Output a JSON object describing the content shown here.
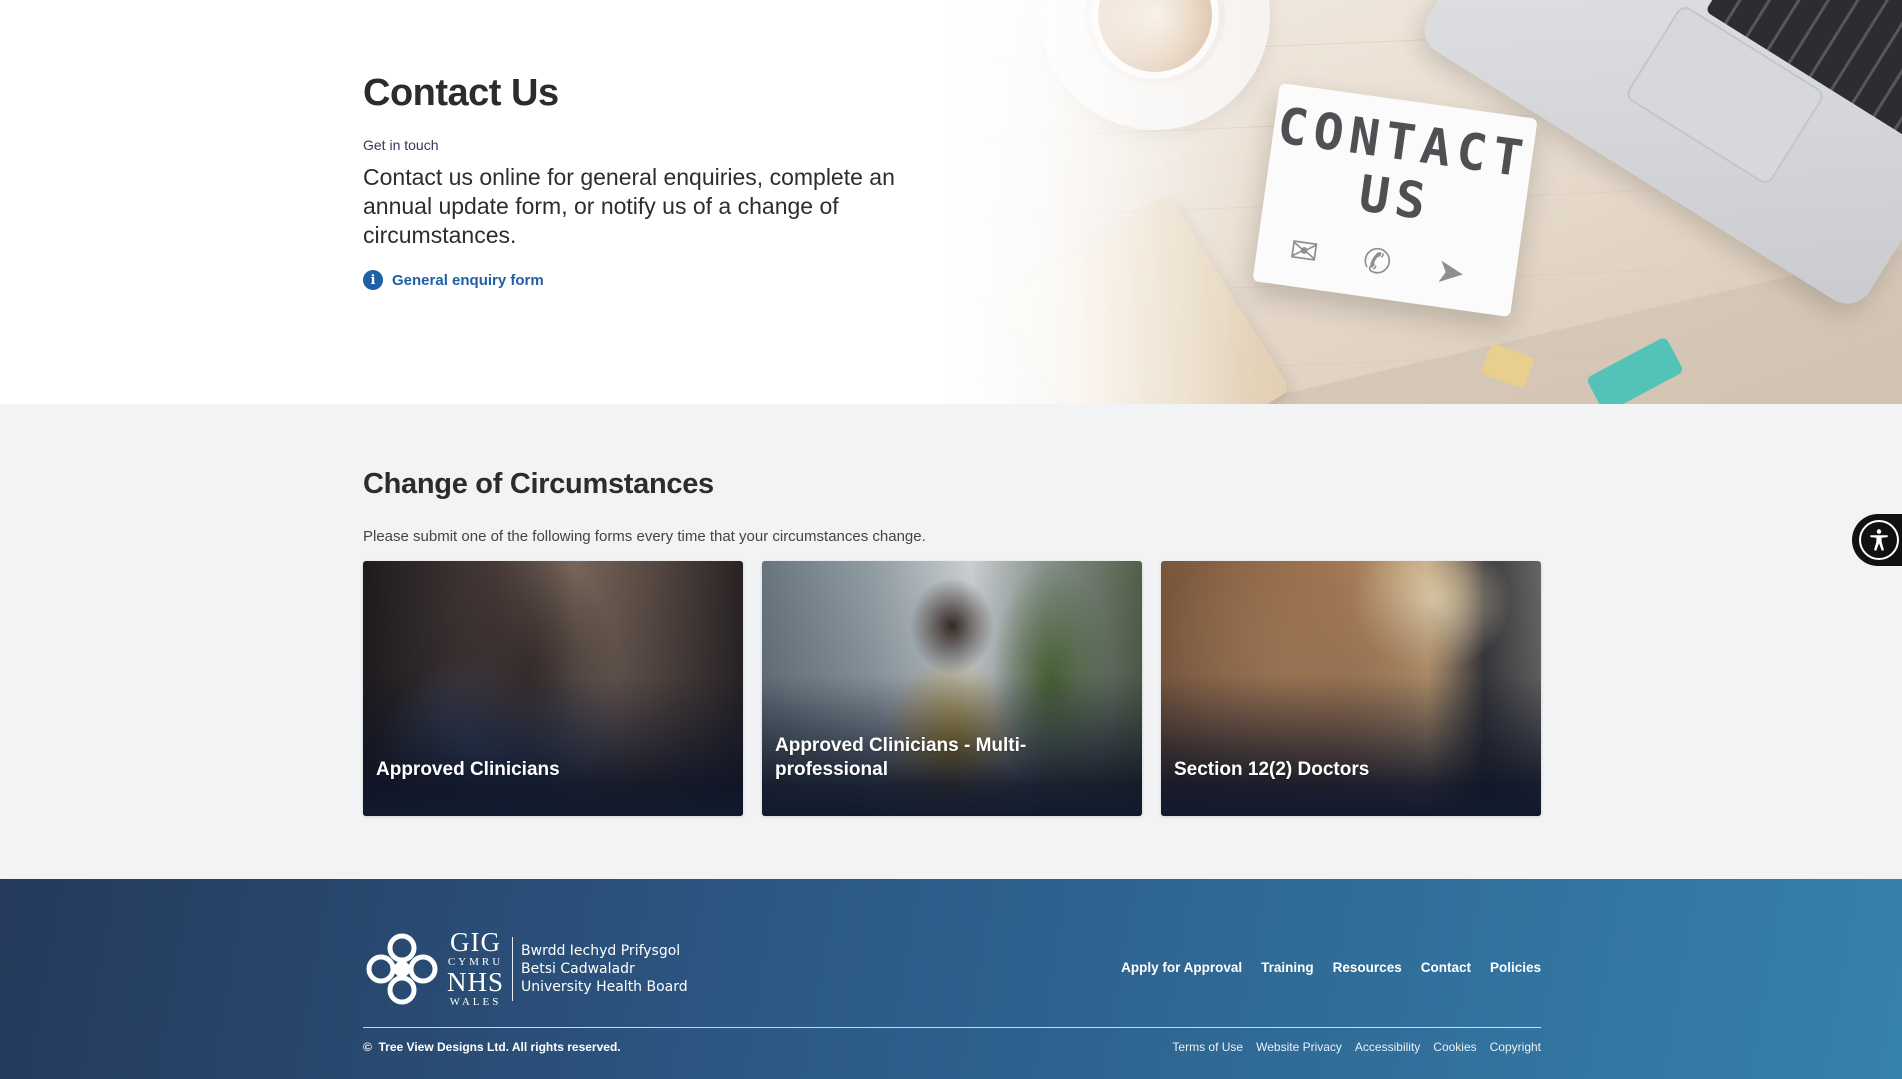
{
  "hero": {
    "title": "Contact Us",
    "eyebrow": "Get in touch",
    "lead": "Contact us online for general enquiries, complete an annual update form, or notify us of a change of circumstances.",
    "enquiry_link": "General enquiry form",
    "enquiry_icon": "info-icon",
    "lightbox_text": "CONTACT US",
    "lightbox_icons": "✉ ✆ ➤"
  },
  "circumstances": {
    "title": "Change of Circumstances",
    "subtitle": "Please submit one of the following forms every time that your circumstances change.",
    "cards": [
      {
        "label": "Approved Clinicians"
      },
      {
        "label": "Approved Clinicians - Multi-professional"
      },
      {
        "label": "Section 12(2) Doctors"
      }
    ]
  },
  "accessibility": {
    "icon": "accessibility-icon"
  },
  "footer": {
    "logo": {
      "gig": "GIG",
      "cymru": "CYMRU",
      "nhs": "NHS",
      "wales": "WALES",
      "board_lines": [
        "Bwrdd Iechyd Prifysgol",
        "Betsi Cadwaladr",
        "University Health Board"
      ]
    },
    "nav": [
      "Apply for Approval",
      "Training",
      "Resources",
      "Contact",
      "Policies"
    ],
    "copyright_symbol": "©",
    "copyright": "Tree View Designs Ltd. All rights reserved.",
    "legal": [
      "Terms of Use",
      "Website Privacy",
      "Accessibility",
      "Cookies",
      "Copyright"
    ]
  },
  "colors": {
    "link": "#1f5fa8",
    "footer_start": "#253a5b",
    "footer_end": "#3582ad",
    "page_bg": "#f2f3f5"
  }
}
